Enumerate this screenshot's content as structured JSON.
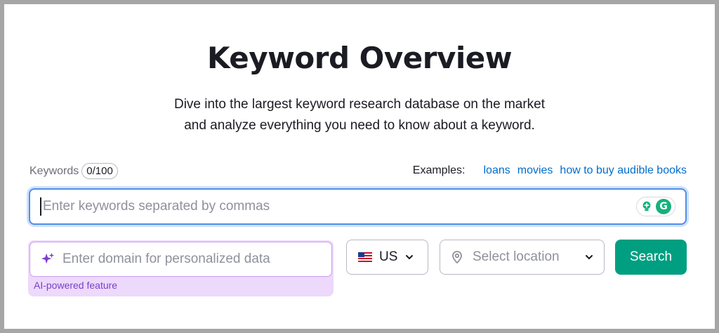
{
  "header": {
    "title": "Keyword Overview",
    "subtitle_line1": "Dive into the largest keyword research database on the market",
    "subtitle_line2": "and analyze everything you need to know about a keyword."
  },
  "keywords": {
    "label": "Keywords",
    "count": "0/100",
    "placeholder": "Enter keywords separated by commas",
    "value": ""
  },
  "examples": {
    "label": "Examples:",
    "items": [
      "loans",
      "movies",
      "how to buy audible books"
    ]
  },
  "domain": {
    "placeholder": "Enter domain for personalized data",
    "ai_label": "AI-powered feature"
  },
  "country": {
    "selected": "US",
    "flag": "us-flag-icon"
  },
  "location": {
    "placeholder": "Select location"
  },
  "search": {
    "label": "Search"
  },
  "colors": {
    "accent": "#009f81",
    "link": "#006dca",
    "focus": "#4e8fe8",
    "ai_bg": "#ecd9fb",
    "ai_text": "#7c3fc9"
  },
  "icons": {
    "sparkle": "sparkle-icon",
    "pin": "location-pin-icon",
    "chevron": "chevron-down-icon",
    "grammarly": "grammarly-icon"
  }
}
